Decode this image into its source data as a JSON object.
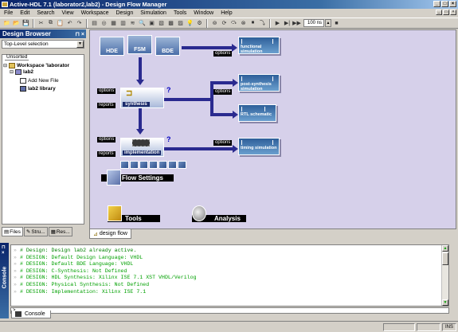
{
  "window": {
    "title": "Active-HDL 7.1 (laborator2,lab2) - Design Flow Manager",
    "controls": [
      "_",
      "□",
      "×"
    ]
  },
  "menu": [
    "File",
    "Edit",
    "Search",
    "View",
    "Workspace",
    "Design",
    "Simulation",
    "Tools",
    "Window",
    "Help"
  ],
  "toolbar": {
    "time_value": "100 ns"
  },
  "design_browser": {
    "title": "Design Browser",
    "filter": "Top-Level selection",
    "tree_tab": "Unsorted",
    "tree": {
      "workspace": "Workspace 'laborator",
      "design": "lab2",
      "add_new_file": "Add New File",
      "library": "lab2 library"
    },
    "tabs": [
      "Files",
      "Stru...",
      "Res..."
    ]
  },
  "flow": {
    "source_boxes": [
      "HDE",
      "FSM",
      "BDE"
    ],
    "options_label": "options",
    "reports_label": "reports",
    "stages": {
      "synthesis": "synthesis",
      "implementation": "implementation"
    },
    "outputs": {
      "functional": "functional simulation",
      "post_synthesis": "post-synthesis simulation",
      "rtl": "RTL schematic",
      "timing": "timing simulation"
    },
    "flow_settings": "Flow Settings",
    "tools": "Tools",
    "analysis": "Analysis",
    "help_mark": "?"
  },
  "document_tab": "design flow",
  "console": {
    "side_title": "Console",
    "lines": [
      "# Design: Design lab2 already active.",
      "# DESIGN: Default Design Language: VHDL",
      "# DESIGN: Default BDE Language: VHDL",
      "# DESIGN: C-Synthesis: Not Defined",
      "# DESIGN: HDL Synthesis: Xilinx ISE 7.1 XST VHDL/Verilog",
      "# DESIGN: Physical Synthesis: Not Defined",
      "# DESIGN: Implementation: Xilinx ISE 7.1"
    ],
    "tab": "Console",
    "prompt": ">"
  },
  "statusbar": {
    "ins": "INS"
  },
  "colors": {
    "title_gradient_start": "#0a246a",
    "canvas_bg": "#d6d0ea",
    "flow_arrow": "#2a2a8f",
    "console_text": "#00a000"
  }
}
